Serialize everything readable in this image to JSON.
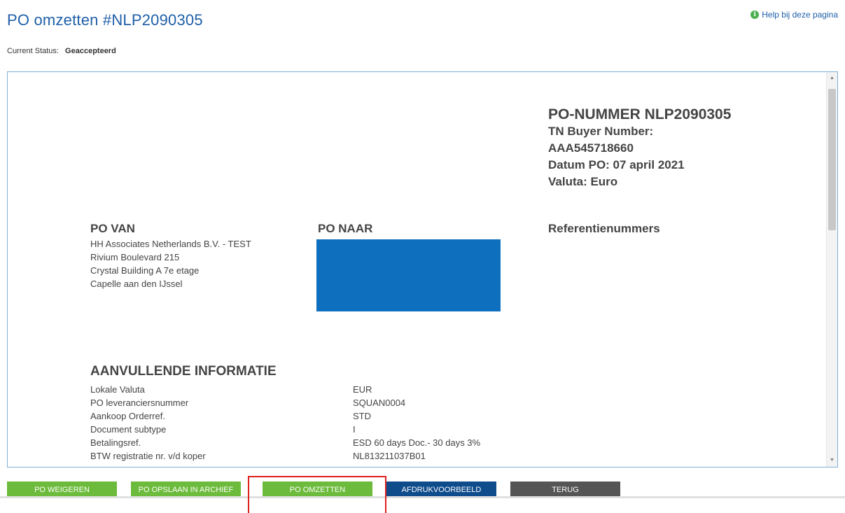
{
  "header": {
    "title": "PO omzetten #NLP2090305",
    "help_label": "Help bij deze pagina",
    "help_icon": "info-icon"
  },
  "status": {
    "label": "Current Status:",
    "value": "Geaccepteerd"
  },
  "document": {
    "po_number": "PO-NUMMER NLP2090305",
    "buyer_label": "TN Buyer Number:",
    "buyer_value": "AAA545718660",
    "date": "Datum PO: 07 april 2021",
    "currency": "Valuta: Euro",
    "po_van": {
      "title": "PO VAN",
      "lines": [
        "HH Associates Netherlands B.V. - TEST",
        "Rivium Boulevard 215",
        "Crystal Building A 7e etage",
        "Capelle aan den IJssel"
      ]
    },
    "po_naar_title": "PO NAAR",
    "references_title": "Referentienummers",
    "extra": {
      "title": "AANVULLENDE INFORMATIE",
      "rows": [
        {
          "label": "Lokale Valuta",
          "value": "EUR"
        },
        {
          "label": "PO leveranciersnummer",
          "value": "SQUAN0004"
        },
        {
          "label": "Aankoop Orderref.",
          "value": "STD"
        },
        {
          "label": "Document subtype",
          "value": "I"
        },
        {
          "label": "Betalingsref.",
          "value": "ESD 60 days Doc.- 30 days 3%"
        },
        {
          "label": "BTW registratie nr. v/d koper",
          "value": "NL813211037B01"
        }
      ]
    }
  },
  "buttons": {
    "reject": "PO WEIGEREN",
    "archive": "PO OPSLAAN IN ARCHIEF",
    "convert": "PO OMZETTEN",
    "preview": "AFDRUKVOORBEELD",
    "back": "TERUG"
  },
  "colors": {
    "title": "#1f5fa8",
    "green_button": "#6dbb3c",
    "blue_button": "#0f4c8c",
    "gray_button": "#555555",
    "highlight": "#e02020",
    "redaction": "#0d6fbe"
  }
}
